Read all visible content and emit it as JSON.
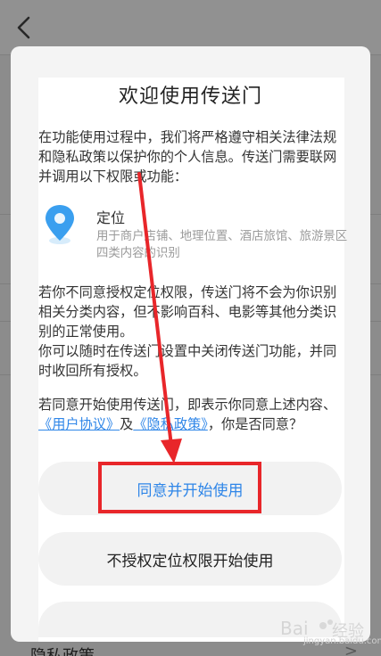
{
  "background": {
    "bottom_item": "隐私政策",
    "bottom_arrow": ">"
  },
  "dialog": {
    "title": "欢迎使用传送门",
    "intro": "在功能使用过程中，我们将严格遵守相关法律法规和隐私政策以保护你的个人信息。传送门需要联网并调用以下权限或功能：",
    "permission": {
      "icon": "location-pin-icon",
      "name": "定位",
      "description": "用于商户店铺、地理位置、酒店旅馆、旅游景区四类内容的识别"
    },
    "disagree_note": "若你不同意授权定位权限，传送门将不会为你识别相关分类内容，但不影响百科、电影等其他分类识别的正常使用。",
    "close_note": "你可以随时在传送门设置中关闭传送门功能，并同时收回所有授权。",
    "consent_prefix": "若同意开始使用传送门，即表示你同意上述内容、",
    "user_agreement_link": "《用户协议》",
    "and_text": "及",
    "privacy_policy_link": "《隐私政策》",
    "consent_suffix": "，你是否同意？",
    "agree_button": "同意并开始使用",
    "no_auth_button": "不授权定位权限开始使用"
  },
  "colors": {
    "accent": "#2f86e8",
    "annotation_red": "#e8262a"
  },
  "watermark": {
    "text": "jingyan.baidu.com"
  }
}
